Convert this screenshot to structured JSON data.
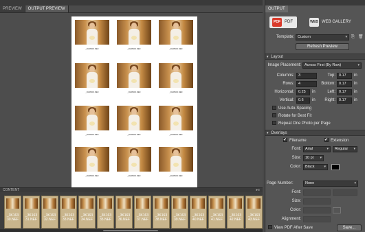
{
  "left_tabs": [
    {
      "label": "PREVIEW"
    },
    {
      "label": "OUTPUT PREVIEW"
    }
  ],
  "thumb_caption": "_DH8603.NEF",
  "content": {
    "label": "CONTENT"
  },
  "filmstrip": [
    {
      "name": "_3K163 30.NEF",
      "n1": "_3K163",
      "n2": "30.NEF"
    },
    {
      "name": "_3K163 31.NEF",
      "n1": "_3K163",
      "n2": "31.NEF"
    },
    {
      "name": "_3K163 32.NEF",
      "n1": "_3K163",
      "n2": "32.NEF"
    },
    {
      "name": "_3K163 33.NEF",
      "n1": "_3K163",
      "n2": "33.NEF"
    },
    {
      "name": "_3K163 34.NEF",
      "n1": "_3K163",
      "n2": "34.NEF"
    },
    {
      "name": "_3K163 35.NEF",
      "n1": "_3K163",
      "n2": "35.NEF"
    },
    {
      "name": "_3K163 36.NEF",
      "n1": "_3K163",
      "n2": "36.NEF"
    },
    {
      "name": "_3K163 37.NEF",
      "n1": "_3K163",
      "n2": "37.NEF"
    },
    {
      "name": "_3K163 38.NEF",
      "n1": "_3K163",
      "n2": "38.NEF"
    },
    {
      "name": "_3K163 39.NEF",
      "n1": "_3K163",
      "n2": "39.NEF"
    },
    {
      "name": "_3K163 40.NEF",
      "n1": "_3K163",
      "n2": "40.NEF"
    },
    {
      "name": "_3K163 41.NEF",
      "n1": "_3K163",
      "n2": "41.NEF"
    },
    {
      "name": "_3K163 42.NEF",
      "n1": "_3K163",
      "n2": "42.NEF"
    },
    {
      "name": "_3K163 43.NEF",
      "n1": "_3K163",
      "n2": "43.NEF"
    }
  ],
  "right": {
    "tab": "OUTPUT",
    "pdf_label": "PDF",
    "pdf_icon": "PDF",
    "web_label": "WEB GALLERY",
    "web_icon": "WEB",
    "template_label": "Template:",
    "template_value": "Custom",
    "refresh_label": "Refresh Preview",
    "layout_section": "Layout",
    "placement_label": "Image Placement:",
    "placement_value": "Across First (By Row)",
    "columns_label": "Columns:",
    "columns_value": "3",
    "rows_label": "Rows:",
    "rows_value": "4",
    "horizontal_label": "Horizontal:",
    "horizontal_value": "0.25",
    "vertical_label": "Vertical:",
    "vertical_value": "0.6",
    "top_label": "Top:",
    "top_value": "0.17",
    "bottom_label": "Bottom:",
    "bottom_value": "0.17",
    "left_label": "Left:",
    "left_value": "0.17",
    "right_label": "Right:",
    "right_value": "0.17",
    "unit": "in",
    "auto_spacing": "Use Auto-Spacing",
    "rotate_fit": "Rotate for Best Fit",
    "repeat_photo": "Repeat One Photo per Page",
    "overlays_section": "Overlays",
    "filename_label": "Filename",
    "extension_label": "Extension",
    "font_label": "Font:",
    "font_value": "Arial",
    "style_value": "Regular",
    "size_label": "Size:",
    "size_value": "10 pt",
    "color_label": "Color:",
    "color_value": "Black",
    "page_number_label": "Page Number:",
    "page_number_value": "None",
    "pn_font_label": "Font:",
    "pn_size_label": "Size:",
    "pn_color_label": "Color:",
    "alignment_label": "Alignment:",
    "view_pdf_label": "View PDF After Save",
    "save_label": "Save..."
  },
  "colors": {
    "accent": "#d93a2b",
    "panel": "#555555",
    "background": "#4b4b4b"
  }
}
